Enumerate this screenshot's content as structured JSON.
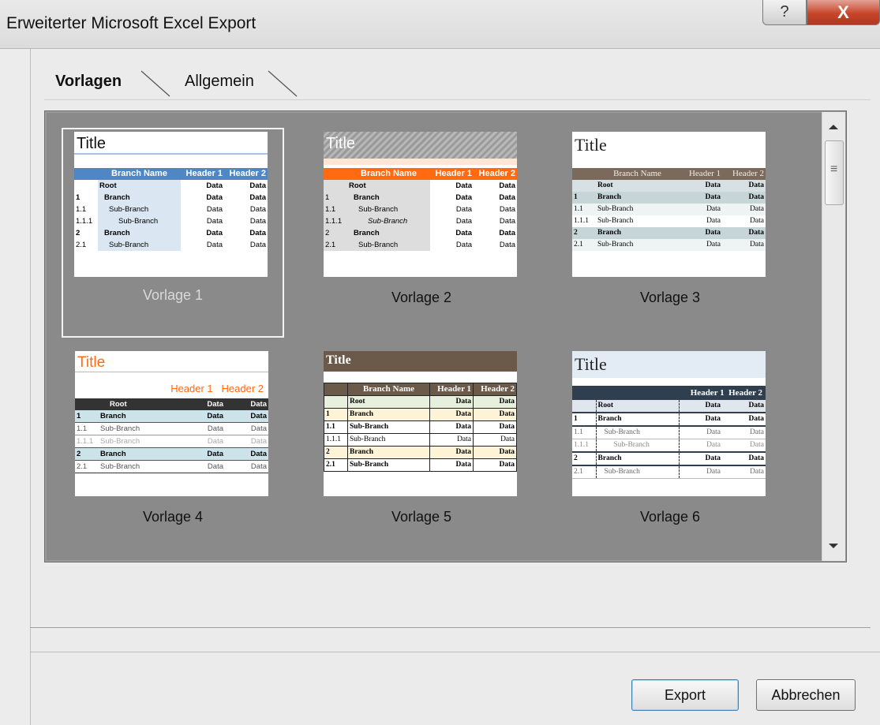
{
  "window": {
    "title": "Erweiterter Microsoft Excel Export",
    "help_label": "?",
    "close_label": "X"
  },
  "tabs": [
    {
      "label": "Vorlagen",
      "active": true
    },
    {
      "label": "Allgemein",
      "active": false
    }
  ],
  "templates": [
    {
      "label": "Vorlage 1",
      "title": "Title",
      "headers": [
        "Branch Name",
        "Header 1",
        "Header 2"
      ],
      "rows": [
        [
          "",
          "Root",
          "Data",
          "Data"
        ],
        [
          "1",
          "Branch",
          "Data",
          "Data"
        ],
        [
          "1.1",
          "Sub-Branch",
          "Data",
          "Data"
        ],
        [
          "1.1.1",
          "Sub-Branch",
          "Data",
          "Data"
        ],
        [
          "2",
          "Branch",
          "Data",
          "Data"
        ],
        [
          "2.1",
          "Sub-Branch",
          "Data",
          "Data"
        ]
      ]
    },
    {
      "label": "Vorlage 2",
      "title": "Title",
      "headers": [
        "Branch Name",
        "Header 1",
        "Header 2"
      ],
      "rows": [
        [
          "",
          "Root",
          "Data",
          "Data"
        ],
        [
          "1",
          "Branch",
          "Data",
          "Data"
        ],
        [
          "1.1",
          "Sub-Branch",
          "Data",
          "Data"
        ],
        [
          "1.1.1",
          "Sub-Branch",
          "Data",
          "Data"
        ],
        [
          "2",
          "Branch",
          "Data",
          "Data"
        ],
        [
          "2.1",
          "Sub-Branch",
          "Data",
          "Data"
        ]
      ]
    },
    {
      "label": "Vorlage 3",
      "title": "Title",
      "headers": [
        "Branch Name",
        "Header 1",
        "Header 2"
      ],
      "rows": [
        [
          "",
          "Root",
          "Data",
          "Data"
        ],
        [
          "1",
          "Branch",
          "Data",
          "Data"
        ],
        [
          "1.1",
          "Sub-Branch",
          "Data",
          "Data"
        ],
        [
          "1.1.1",
          "Sub-Branch",
          "Data",
          "Data"
        ],
        [
          "2",
          "Branch",
          "Data",
          "Data"
        ],
        [
          "2.1",
          "Sub-Branch",
          "Data",
          "Data"
        ]
      ]
    },
    {
      "label": "Vorlage 4",
      "title": "Title",
      "headers": [
        "Header 1",
        "Header 2"
      ],
      "rows": [
        [
          "",
          "Root",
          "Data",
          "Data"
        ],
        [
          "1",
          "Branch",
          "Data",
          "Data"
        ],
        [
          "1.1",
          "Sub-Branch",
          "Data",
          "Data"
        ],
        [
          "1.1.1",
          "Sub-Branch",
          "Data",
          "Data"
        ],
        [
          "2",
          "Branch",
          "Data",
          "Data"
        ],
        [
          "2.1",
          "Sub-Branch",
          "Data",
          "Data"
        ]
      ]
    },
    {
      "label": "Vorlage 5",
      "title": "Title",
      "headers": [
        "Branch Name",
        "Header 1",
        "Header 2"
      ],
      "rows": [
        [
          "",
          "Root",
          "Data",
          "Data"
        ],
        [
          "1",
          "Branch",
          "Data",
          "Data"
        ],
        [
          "1.1",
          "Sub-Branch",
          "Data",
          "Data"
        ],
        [
          "1.1.1",
          "Sub-Branch",
          "Data",
          "Data"
        ],
        [
          "2",
          "Branch",
          "Data",
          "Data"
        ],
        [
          "2.1",
          "Sub-Branch",
          "Data",
          "Data"
        ]
      ]
    },
    {
      "label": "Vorlage 6",
      "title": "Title",
      "headers": [
        "Header 1",
        "Header 2"
      ],
      "rows": [
        [
          "",
          "Root",
          "Data",
          "Data"
        ],
        [
          "1",
          "Branch",
          "Data",
          "Data"
        ],
        [
          "1.1",
          "Sub-Branch",
          "Data",
          "Data"
        ],
        [
          "1.1.1",
          "Sub-Branch",
          "Data",
          "Data"
        ],
        [
          "2",
          "Branch",
          "Data",
          "Data"
        ],
        [
          "2.1",
          "Sub-Branch",
          "Data",
          "Data"
        ]
      ]
    }
  ],
  "buttons": {
    "export": "Export",
    "cancel": "Abbrechen"
  },
  "colors": {
    "gallery_bg": "#8a8a8a",
    "accent_blue": "#4f86c6",
    "accent_orange": "#ff6a13",
    "accent_brown": "#6b5a4a"
  }
}
